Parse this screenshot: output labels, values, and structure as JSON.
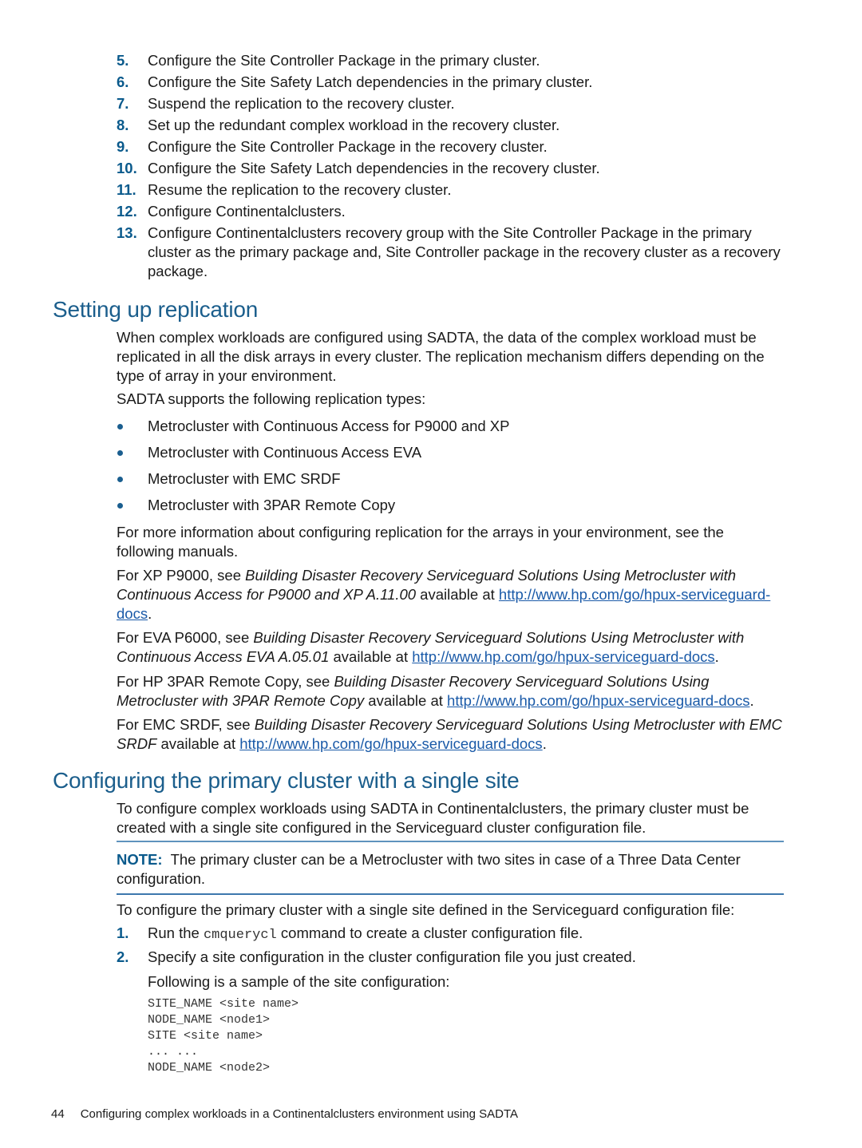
{
  "steps_top": [
    {
      "num": "5.",
      "text": "Configure the Site Controller Package in the primary cluster."
    },
    {
      "num": "6.",
      "text": "Configure the Site Safety Latch dependencies in the primary cluster."
    },
    {
      "num": "7.",
      "text": "Suspend the replication to the recovery cluster."
    },
    {
      "num": "8.",
      "text": "Set up the redundant complex workload in the recovery cluster."
    },
    {
      "num": "9.",
      "text": "Configure the Site Controller Package in the recovery cluster."
    },
    {
      "num": "10.",
      "text": "Configure the Site Safety Latch dependencies in the recovery cluster."
    },
    {
      "num": "11.",
      "text": "Resume the replication to the recovery cluster."
    },
    {
      "num": "12.",
      "text": "Configure Continentalclusters."
    },
    {
      "num": "13.",
      "text": "Configure Continentalclusters recovery group with the Site Controller Package in the primary cluster as the primary package and, Site Controller package in the recovery cluster as a recovery package."
    }
  ],
  "section_replication": {
    "heading": "Setting up replication",
    "intro": "When complex workloads are configured using SADTA, the data of the complex workload must be replicated in all the disk arrays in every cluster. The replication mechanism differs depending on the type of array in your environment.",
    "supports": "SADTA supports the following replication types:",
    "bullets": [
      "Metrocluster with Continuous Access for P9000 and XP",
      "Metrocluster with Continuous Access EVA",
      "Metrocluster with EMC SRDF",
      "Metrocluster with 3PAR Remote Copy"
    ],
    "more_info": "For more information about configuring replication for the arrays in your environment, see the following manuals.",
    "manuals": [
      {
        "prefix": "For XP P9000, see ",
        "title": "Building Disaster Recovery Serviceguard Solutions Using Metrocluster with Continuous Access for P9000 and XP A.11.00",
        "middle": " available at ",
        "link": "http://www.hp.com/go/hpux-serviceguard-docs",
        "suffix": "."
      },
      {
        "prefix": "For EVA P6000, see ",
        "title": "Building Disaster Recovery Serviceguard Solutions Using Metrocluster with Continuous Access EVA A.05.01",
        "middle": " available at ",
        "link": "http://www.hp.com/go/hpux-serviceguard-docs",
        "suffix": "."
      },
      {
        "prefix": "For HP 3PAR Remote Copy, see ",
        "title": "Building Disaster Recovery Serviceguard Solutions Using Metrocluster with 3PAR Remote Copy",
        "middle": " available at ",
        "link": "http://www.hp.com/go/hpux-serviceguard-docs",
        "suffix": "."
      },
      {
        "prefix": "For EMC SRDF, see ",
        "title": "Building Disaster Recovery Serviceguard Solutions Using Metrocluster with EMC SRDF",
        "middle": " available at ",
        "link": " http://www.hp.com/go/hpux-serviceguard-docs",
        "suffix": "."
      }
    ]
  },
  "section_primary": {
    "heading": "Configuring the primary cluster with a single site",
    "intro": "To configure complex workloads using SADTA in Continentalclusters, the primary cluster must be created with a single site configured in the Serviceguard cluster configuration file.",
    "note_label": "NOTE:",
    "note_text": "The primary cluster can be a Metrocluster with two sites in case of a Three Data Center configuration.",
    "lead": "To configure the primary cluster with a single site defined in the Serviceguard configuration file:",
    "steps": [
      {
        "num": "1.",
        "pre": "Run the ",
        "code": "cmquerycl",
        "post": " command to create a cluster configuration file."
      },
      {
        "num": "2.",
        "pre": "Specify a site configuration in the cluster configuration file you just created.",
        "code": "",
        "post": ""
      }
    ],
    "sample_lead": "Following is a sample of the site configuration:",
    "code_sample": "SITE_NAME <site name>\nNODE_NAME <node1>\nSITE <site name>\n... ...\nNODE_NAME <node2>"
  },
  "footer": {
    "page_number": "44",
    "chapter_title": "Configuring complex workloads in a Continentalclusters environment using SADTA"
  }
}
